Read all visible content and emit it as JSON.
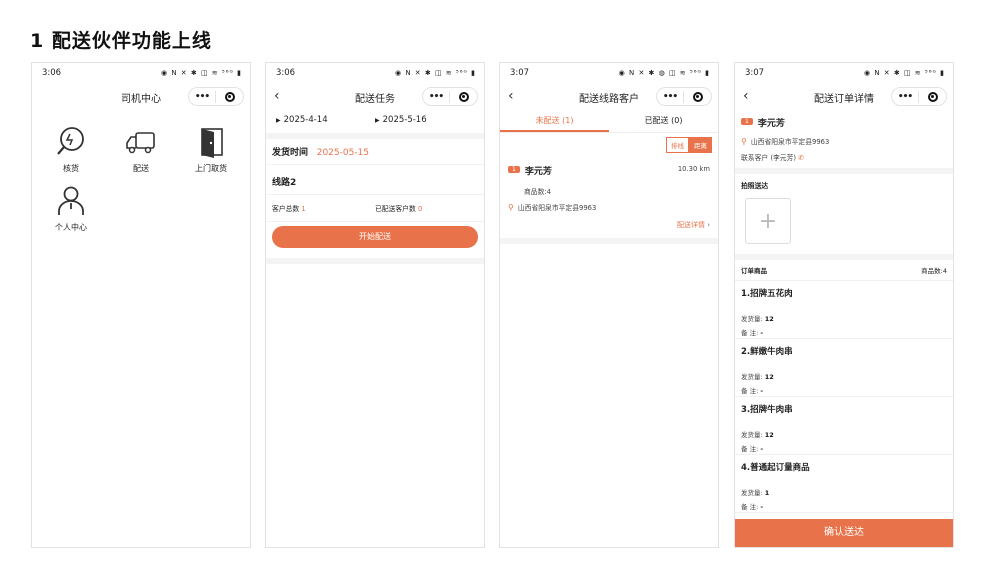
{
  "title": "1 配送伙伴功能上线",
  "phone1": {
    "time": "3:06",
    "status_icons": "◉ N ✕ ✱ ◫ ≋ ⁵⁶ᴳ ▮",
    "nav_title": "司机中心",
    "capsule_more": "•••",
    "grid": [
      {
        "label": "核货",
        "icon": "verify-icon"
      },
      {
        "label": "配送",
        "icon": "truck-icon"
      },
      {
        "label": "上门取货",
        "icon": "door-icon"
      },
      {
        "label": "个人中心",
        "icon": "person-icon"
      }
    ]
  },
  "phone2": {
    "time": "3:06",
    "status_icons": "◉ N ✕ ✱ ◫ ≋ ⁵⁶ᴳ ▮",
    "nav_title": "配送任务",
    "capsule_more": "•••",
    "date_start": "2025-4-14",
    "date_end": "2025-5-16",
    "ship_time_label": "发货时间",
    "ship_time_value": "2025-05-15",
    "route": "线路2",
    "customer_total_label": "客户总数",
    "customer_total_value": "1",
    "delivered_label": "已配送客户数",
    "delivered_value": "0",
    "start_button": "开始配送"
  },
  "phone3": {
    "time": "3:07",
    "status_icons": "◉ N ✕ ✱ ◍ ◫ ≋ ⁵⁶ᴳ ▮",
    "nav_title": "配送线路客户",
    "capsule_more": "•••",
    "tab_pending": "未配送 (1)",
    "tab_done": "已配送 (0)",
    "toggle_sort": "排线",
    "toggle_distance": "距离",
    "customer": {
      "index": "1",
      "name": "李元芳",
      "distance": "10.30 km",
      "goods_count": "商品数:4",
      "address": "山西省阳泉市平定县9963",
      "detail_link": "配送详情"
    }
  },
  "phone4": {
    "time": "3:07",
    "status_icons": "◉ N ✕ ✱ ◫ ≋ ⁵⁶ᴳ ▮",
    "nav_title": "配送订单详情",
    "capsule_more": "•••",
    "index": "1",
    "name": "李元芳",
    "address": "山西省阳泉市平定县9963",
    "contact": "联系客户 (李元芳)",
    "photo_label": "拍照送达",
    "order_goods_label": "订单商品",
    "goods_count": "商品数:4",
    "ship_qty_label": "发货量:",
    "remark_label": "备 注:",
    "products": [
      {
        "name": "1.招牌五花肉",
        "qty": "12",
        "remark": "-"
      },
      {
        "name": "2.鲜嫩牛肉串",
        "qty": "12",
        "remark": "-"
      },
      {
        "name": "3.招牌牛肉串",
        "qty": "12",
        "remark": "-"
      },
      {
        "name": "4.普通起订量商品",
        "qty": "1",
        "remark": "-"
      }
    ],
    "confirm_button": "确认送达"
  }
}
